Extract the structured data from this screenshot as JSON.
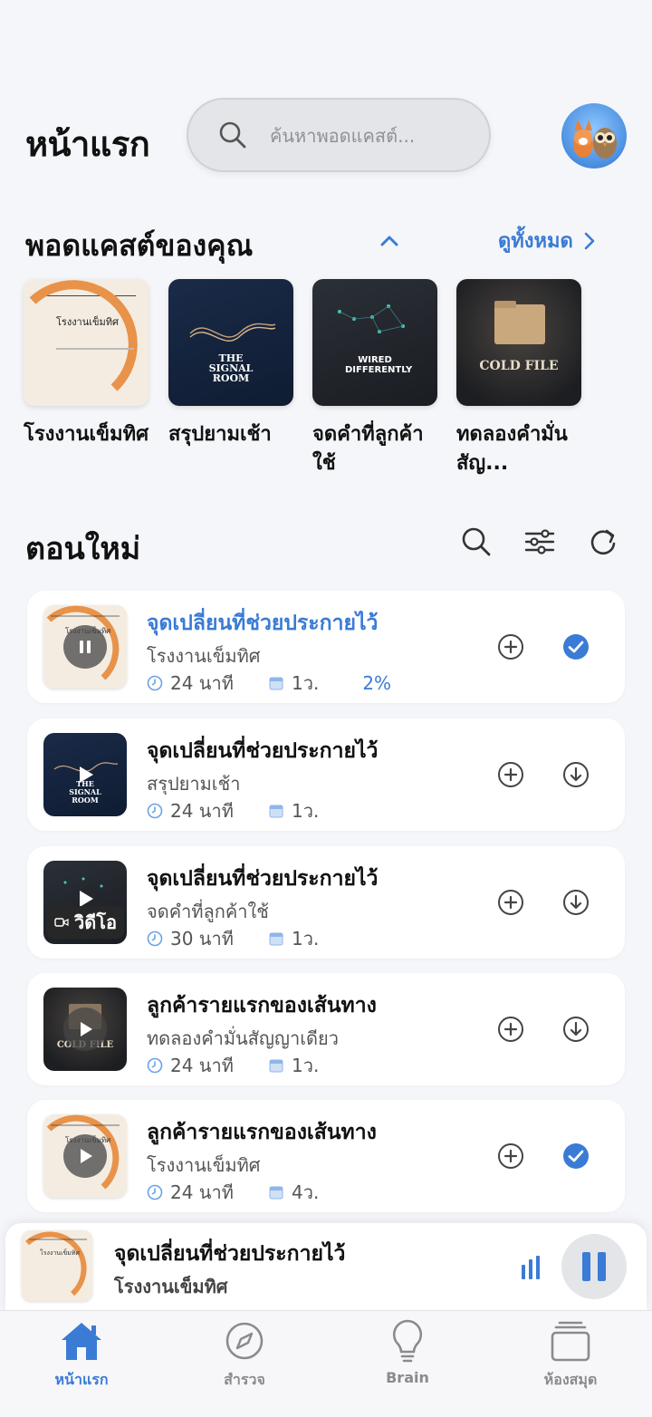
{
  "header": {
    "title": "หน้าแรก",
    "search_placeholder": "ค้นหาพอดแคสต์..."
  },
  "your_podcasts": {
    "title": "พอดแคสต์ของคุณ",
    "see_all_label": "ดูทั้งหมด",
    "items": [
      {
        "name": "โรงงานเข็มทิศ",
        "cover_text": "โรงงานเข็มทิศ",
        "cover_style": "compass"
      },
      {
        "name": "สรุปยามเช้า",
        "cover_text": "THE SIGNAL ROOM",
        "cover_style": "signal"
      },
      {
        "name": "จดคำที่ลูกค้าใช้",
        "cover_text": "WIRED DIFFERENTLY",
        "cover_style": "wired"
      },
      {
        "name": "ทดลองคำมั่นสัญ...",
        "cover_text": "COLD FILE",
        "cover_style": "cold"
      }
    ]
  },
  "episodes": {
    "title": "ตอนใหม่",
    "items": [
      {
        "title": "จุดเปลี่ยนที่ช่วยประกายไว้",
        "show": "โรงงานเข็มทิศ",
        "duration": "24 นาที",
        "date": "1ว.",
        "progress": "2%",
        "state": "playing",
        "downloaded": true,
        "active": true,
        "cover_text": "โรงงานเข็มทิศ"
      },
      {
        "title": "จุดเปลี่ยนที่ช่วยประกายไว้",
        "show": "สรุปยามเช้า",
        "duration": "24 นาที",
        "date": "1ว.",
        "progress": "",
        "state": "paused",
        "downloaded": false,
        "active": false,
        "cover_text": "THE SIGNAL ROOM"
      },
      {
        "title": "จุดเปลี่ยนที่ช่วยประกายไว้",
        "show": "จดคำที่ลูกค้าใช้",
        "duration": "30 นาที",
        "date": "1ว.",
        "progress": "",
        "state": "paused",
        "downloaded": false,
        "active": false,
        "video_label": "วิดีโอ"
      },
      {
        "title": "ลูกค้ารายแรกของเส้นทาง",
        "show": "ทดลองคำมั่นสัญญาเดียว",
        "duration": "24 นาที",
        "date": "1ว.",
        "progress": "",
        "state": "paused",
        "downloaded": false,
        "active": false,
        "cover_text": "COLD FILE"
      },
      {
        "title": "ลูกค้ารายแรกของเส้นทาง",
        "show": "โรงงานเข็มทิศ",
        "duration": "24 นาที",
        "date": "4ว.",
        "progress": "",
        "state": "paused",
        "downloaded": true,
        "active": false,
        "cover_text": "โรงงานเข็มทิศ"
      }
    ]
  },
  "mini_player": {
    "title": "จุดเปลี่ยนที่ช่วยประกายไว้",
    "show": "โรงงานเข็มทิศ",
    "cover_text": "โรงงานเข็มทิศ",
    "progress_fraction": 0.02
  },
  "tab_bar": {
    "items": [
      {
        "label": "หน้าแรก",
        "icon": "home-icon",
        "active": true
      },
      {
        "label": "สำรวจ",
        "icon": "compass-icon",
        "active": false
      },
      {
        "label": "Brain",
        "icon": "lightbulb-icon",
        "active": false
      },
      {
        "label": "ห้องสมุด",
        "icon": "library-icon",
        "active": false
      }
    ]
  },
  "colors": {
    "accent": "#3a7bd5",
    "background": "#f5f6f9"
  }
}
